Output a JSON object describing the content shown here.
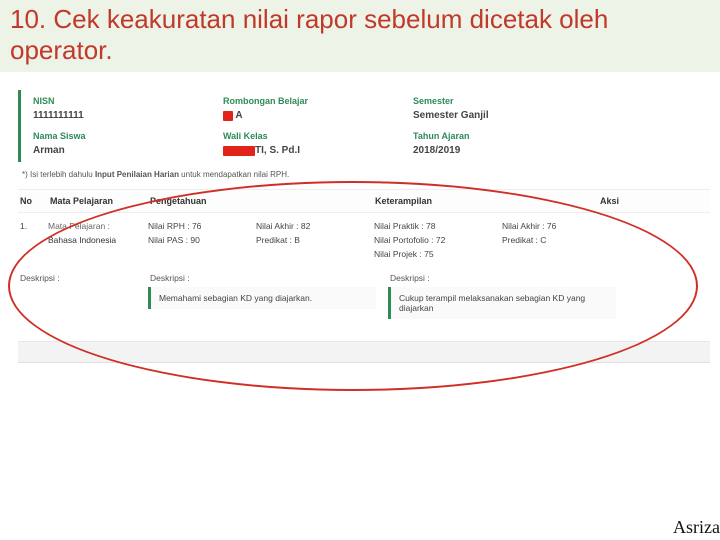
{
  "title": "10. Cek keakuratan nilai rapor sebelum dicetak oleh operator.",
  "info": {
    "nisn_label": "NISN",
    "nisn_value": "1111111111",
    "rombel_label": "Rombongan Belajar",
    "rombel_value": "A",
    "semester_label": "Semester",
    "semester_value": "Semester Ganjil",
    "nama_label": "Nama Siswa",
    "nama_value": "Arman",
    "wali_label": "Wali Kelas",
    "wali_value": "TI, S. Pd.I",
    "tahun_label": "Tahun Ajaran",
    "tahun_value": "2018/2019"
  },
  "note_prefix": "*) Isi terlebih dahulu ",
  "note_bold": "Input Penilaian Harian",
  "note_suffix": " untuk mendapatkan nilai RPH.",
  "head": {
    "no": "No",
    "mapel": "Mata Pelajaran",
    "pengetahuan": "Pengetahuan",
    "keterampilan": "Keterampilan",
    "aksi": "Aksi"
  },
  "row": {
    "no": "1.",
    "mapel_label": "Mata Pelajaran :",
    "mapel_value": "Bahasa Indonesia",
    "rph_label": "Nilai RPH :",
    "rph_value": "76",
    "pas_label": "Nilai PAS :",
    "pas_value": "90",
    "p_akhir_label": "Nilai Akhir :",
    "p_akhir_value": "82",
    "p_pred_label": "Predikat :",
    "p_pred_value": "B",
    "praktik_label": "Nilai Praktik :",
    "praktik_value": "78",
    "porto_label": "Nilai Portofolio :",
    "porto_value": "72",
    "projek_label": "Nilai Projek :",
    "projek_value": "75",
    "k_akhir_label": "Nilai Akhir :",
    "k_akhir_value": "76",
    "k_pred_label": "Predikat :",
    "k_pred_value": "C",
    "desc_label": "Deskripsi :",
    "desc_p": "Memahami sebagian KD yang diajarkan.",
    "desc_k": "Cukup terampil melaksanakan sebagian KD yang diajarkan"
  },
  "footer": "Asriza"
}
